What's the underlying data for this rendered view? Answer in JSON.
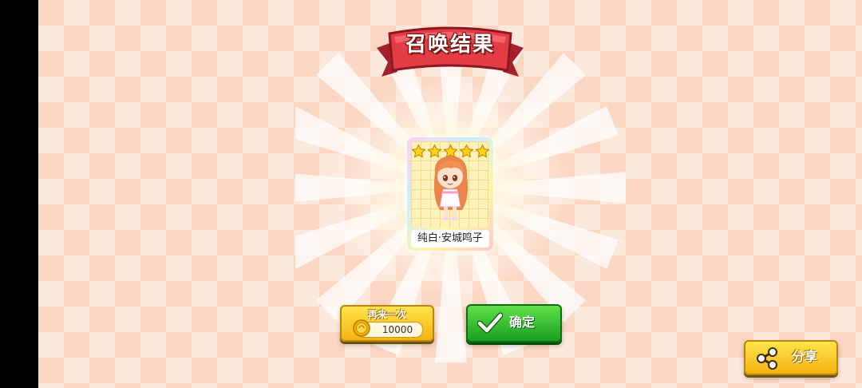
{
  "screen": {
    "title": "召唤结果"
  },
  "card": {
    "name": "纯白·安城鸣子",
    "stars": 5
  },
  "buttons": {
    "again_label": "再来一次",
    "again_cost": "10000",
    "confirm_label": "确定",
    "share_label": "分享"
  },
  "icons": {
    "coin": "coin-icon",
    "check": "check-icon",
    "share": "share-icon",
    "star": "star-icon"
  },
  "colors": {
    "ribbon": "#d63a3a",
    "confirm": "#22a82a",
    "gold_button": "#f7c325",
    "star": "#ffd21a"
  }
}
